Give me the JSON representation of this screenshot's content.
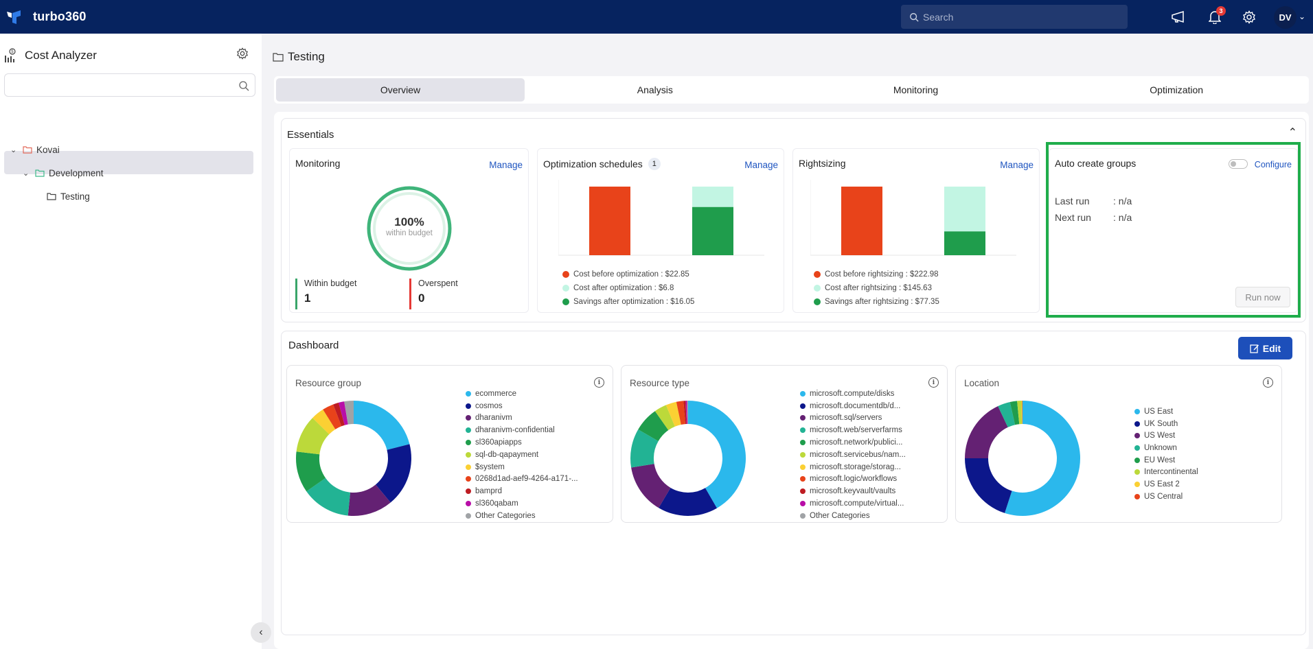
{
  "topbar": {
    "brand": "turbo360",
    "search_placeholder": "Search",
    "notification_count": "3",
    "user_initials": "DV"
  },
  "sidebar": {
    "title": "Cost Analyzer",
    "search_value": "",
    "tree": [
      {
        "label": "Kovai",
        "level": 0,
        "expanded": true,
        "folder_color": "#e26a5a"
      },
      {
        "label": "Development",
        "level": 1,
        "expanded": true,
        "folder_color": "#3fb98a"
      },
      {
        "label": "Testing",
        "level": 2,
        "selected": true,
        "folder_color": "#444444"
      }
    ]
  },
  "main": {
    "title": "Testing",
    "tabs": [
      {
        "label": "Overview",
        "active": true
      },
      {
        "label": "Analysis",
        "active": false
      },
      {
        "label": "Monitoring",
        "active": false
      },
      {
        "label": "Optimization",
        "active": false
      }
    ],
    "essentials": {
      "title": "Essentials",
      "monitoring": {
        "title": "Monitoring",
        "manage_label": "Manage",
        "percent": "100%",
        "percent_caption": "within budget",
        "within_budget_fraction": 1.0,
        "within_label": "Within budget",
        "within_value": "1",
        "overspent_label": "Overspent",
        "overspent_value": "0"
      },
      "optimization": {
        "title": "Optimization schedules",
        "count": "1",
        "manage_label": "Manage",
        "legend": [
          {
            "label": "Cost before optimization : $22.85",
            "color": "#e8431a"
          },
          {
            "label": "Cost after optimization : $6.8",
            "color": "#c2f5e3"
          },
          {
            "label": "Savings after optimization : $16.05",
            "color": "#1f9d4c"
          }
        ],
        "values": {
          "before": 22.85,
          "after": 6.8,
          "savings": 16.05
        }
      },
      "rightsizing": {
        "title": "Rightsizing",
        "manage_label": "Manage",
        "legend": [
          {
            "label": "Cost before rightsizing : $222.98",
            "color": "#e8431a"
          },
          {
            "label": "Cost after rightsizing : $145.63",
            "color": "#c2f5e3"
          },
          {
            "label": "Savings after rightsizing : $77.35",
            "color": "#1f9d4c"
          }
        ],
        "values": {
          "before": 222.98,
          "after": 145.63,
          "savings": 77.35
        }
      },
      "auto_create": {
        "title": "Auto create groups",
        "toggle_on": false,
        "configure_label": "Configure",
        "last_run_label": "Last run",
        "last_run_value": ": n/a",
        "next_run_label": "Next run",
        "next_run_value": ": n/a",
        "run_now_label": "Run now"
      }
    },
    "dashboard": {
      "title": "Dashboard",
      "edit_label": "Edit"
    }
  },
  "chart_data": [
    {
      "type": "pie",
      "title": "Resource group",
      "donut": true,
      "legend_placement": "right",
      "categories": [
        "ecommerce",
        "cosmos",
        "dharanivm",
        "dharanivm-confidential",
        "sl360apiapps",
        "sql-db-qapayment",
        "$system",
        "0268d1ad-aef9-4264-a171-...",
        "bamprd",
        "sl360qabam",
        "Other Categories"
      ],
      "values": [
        20,
        17,
        12,
        13,
        11,
        10,
        3.5,
        3,
        1.5,
        1.5,
        2.5
      ],
      "colors": [
        "#2bb8ec",
        "#0c178b",
        "#642173",
        "#22b394",
        "#1f9d4c",
        "#bcd93a",
        "#fbd033",
        "#e8431a",
        "#be1c22",
        "#b80ea7",
        "#a0a3a6"
      ]
    },
    {
      "type": "pie",
      "title": "Resource type",
      "donut": true,
      "legend_placement": "right",
      "categories": [
        "microsoft.compute/disks",
        "microsoft.documentdb/d...",
        "microsoft.sql/servers",
        "microsoft.web/serverfarms",
        "microsoft.network/publici...",
        "microsoft.servicebus/nam...",
        "microsoft.storage/storag...",
        "microsoft.logic/workflows",
        "microsoft.keyvault/vaults",
        "microsoft.compute/virtual...",
        "Other Categories"
      ],
      "values": [
        42,
        17,
        14,
        11,
        7,
        3.5,
        3,
        2,
        0.6,
        0.4,
        0.3
      ],
      "colors": [
        "#2bb8ec",
        "#0c178b",
        "#642173",
        "#22b394",
        "#1f9d4c",
        "#bcd93a",
        "#fbd033",
        "#e8431a",
        "#be1c22",
        "#b80ea7",
        "#a0a3a6"
      ]
    },
    {
      "type": "pie",
      "title": "Location",
      "donut": true,
      "legend_placement": "right",
      "categories": [
        "US East",
        "UK South",
        "US West",
        "Unknown",
        "EU West",
        "Intercontinental",
        "US East 2",
        "US Central"
      ],
      "values": [
        55,
        20,
        18,
        3.5,
        2,
        1.2,
        0.2,
        0.1
      ],
      "colors": [
        "#2bb8ec",
        "#0c178b",
        "#642173",
        "#22b394",
        "#1f9d4c",
        "#bcd93a",
        "#fbd033",
        "#e8431a"
      ]
    }
  ]
}
